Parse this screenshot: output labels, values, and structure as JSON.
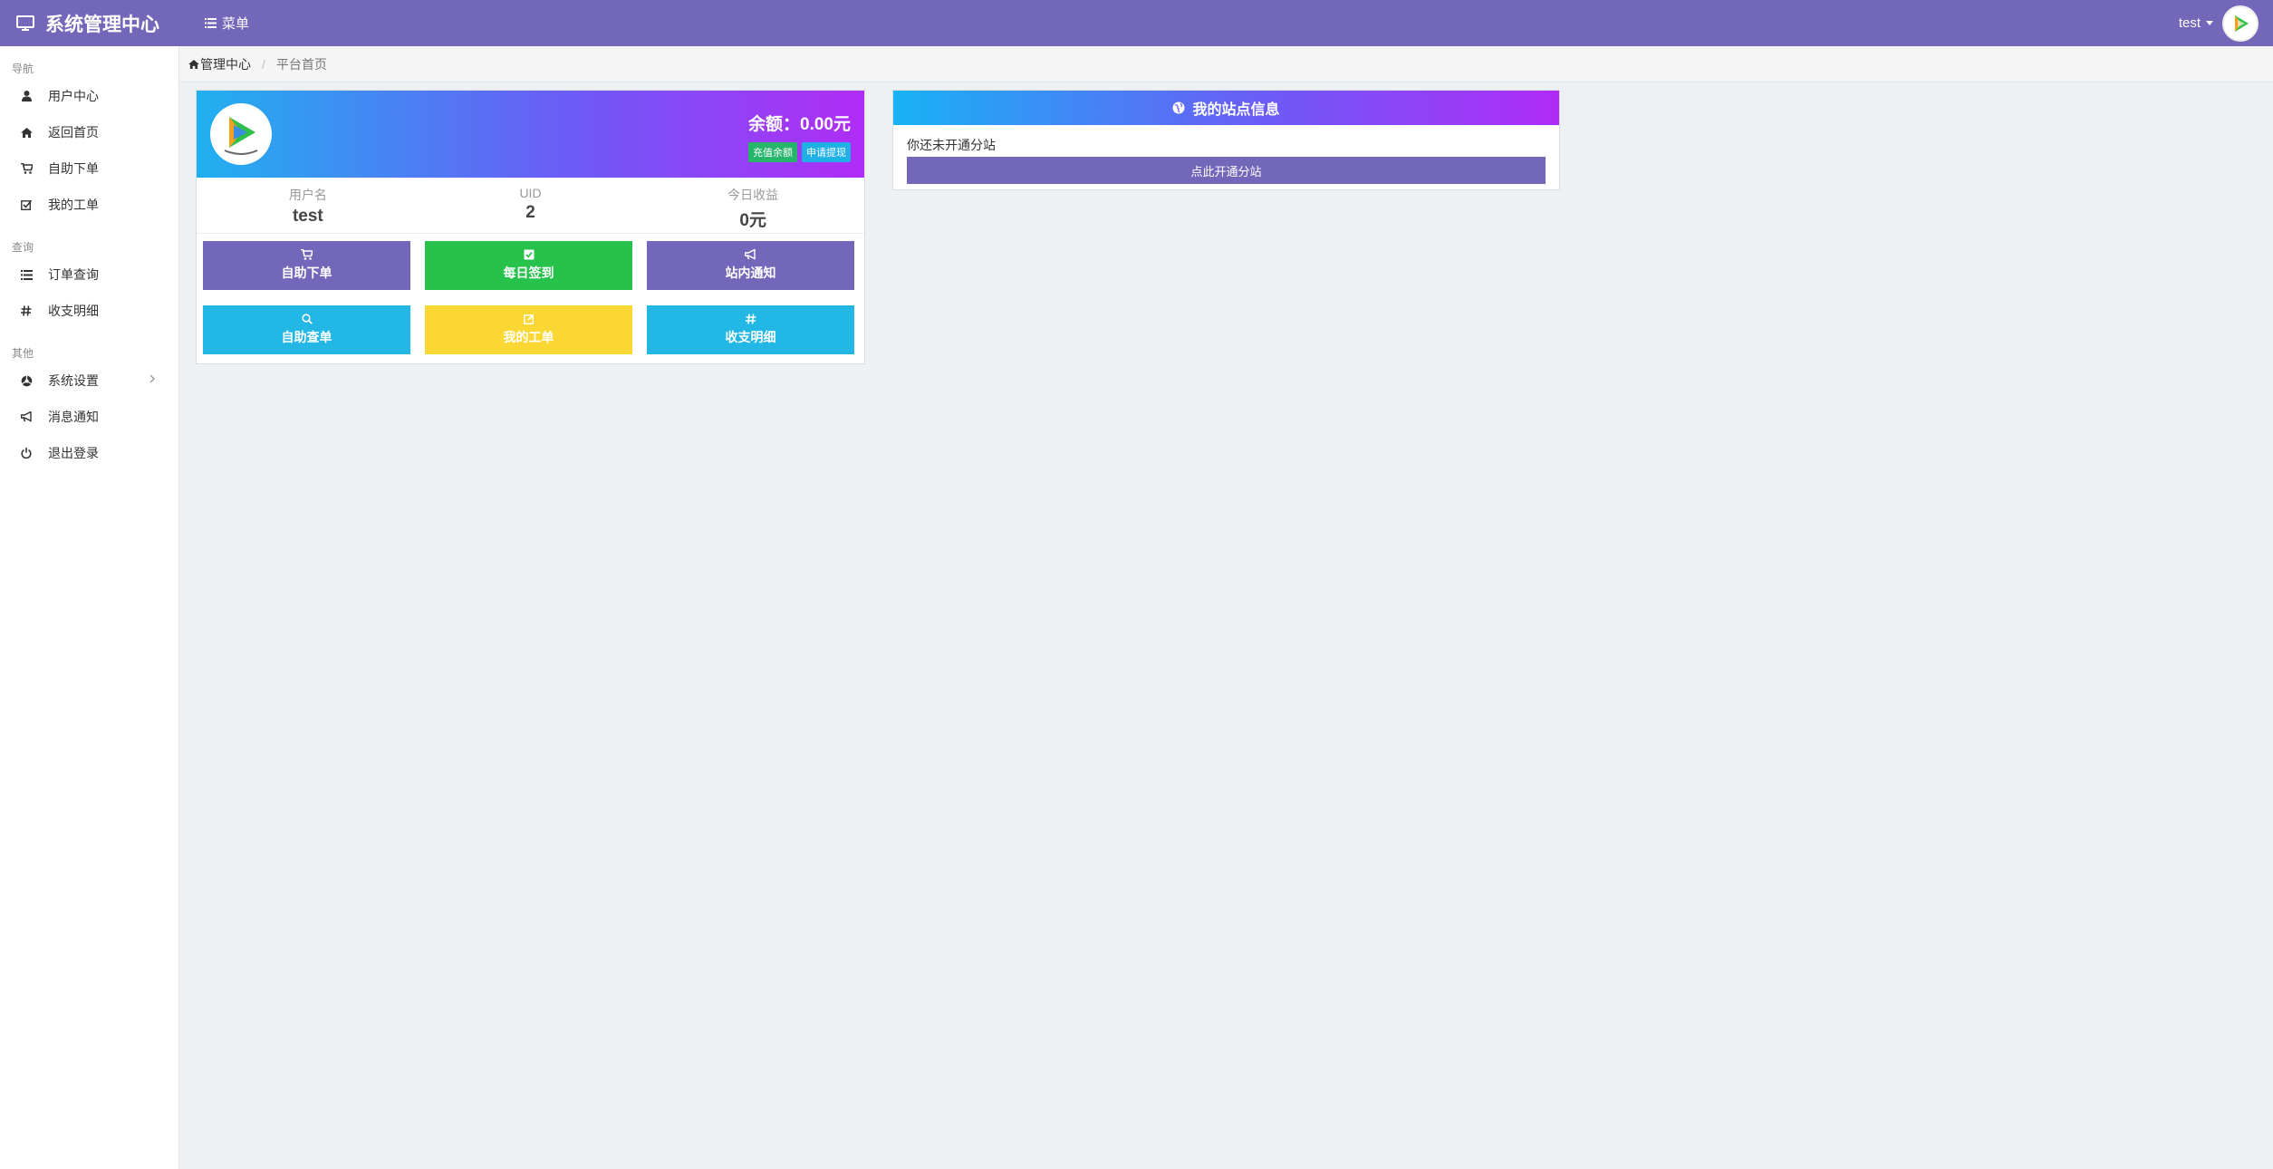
{
  "header": {
    "brand": "系统管理中心",
    "menu_label": "菜单",
    "user_name": "test"
  },
  "sidebar": {
    "sections": [
      {
        "title": "导航",
        "items": [
          {
            "label": "用户中心",
            "icon": "user-icon"
          },
          {
            "label": "返回首页",
            "icon": "home-icon"
          },
          {
            "label": "自助下单",
            "icon": "cart-icon"
          },
          {
            "label": "我的工单",
            "icon": "check-square-icon"
          }
        ]
      },
      {
        "title": "查询",
        "items": [
          {
            "label": "订单查询",
            "icon": "list-icon"
          },
          {
            "label": "收支明细",
            "icon": "hash-icon"
          }
        ]
      },
      {
        "title": "其他",
        "items": [
          {
            "label": "系统设置",
            "icon": "settings-icon"
          },
          {
            "label": "消息通知",
            "icon": "bullhorn-icon"
          },
          {
            "label": "退出登录",
            "icon": "power-icon"
          }
        ]
      }
    ]
  },
  "breadcrumb": {
    "home": "管理中心",
    "current": "平台首页"
  },
  "account": {
    "balance_text": "余额：0.00元",
    "recharge_label": "充值余额",
    "withdraw_label": "申请提现",
    "stats": [
      {
        "label": "用户名",
        "value": "test"
      },
      {
        "label": "UID",
        "value": "2"
      },
      {
        "label": "今日收益",
        "value": "0元"
      }
    ],
    "actions": [
      {
        "label": "自助下单",
        "icon": "cart-icon",
        "color": "#7367b9"
      },
      {
        "label": "每日签到",
        "icon": "check-square-icon",
        "color": "#27c24c"
      },
      {
        "label": "站内通知",
        "icon": "bullhorn-icon",
        "color": "#7367b9"
      },
      {
        "label": "自助查单",
        "icon": "search-icon",
        "color": "#23b7e5"
      },
      {
        "label": "我的工单",
        "icon": "edit-square-icon",
        "color": "#fad733"
      },
      {
        "label": "收支明细",
        "icon": "hash-icon",
        "color": "#23b7e5"
      }
    ]
  },
  "site": {
    "title": "我的站点信息",
    "message": "你还未开通分站",
    "open_label": "点此开通分站"
  },
  "colors": {
    "primary": "#7367b9",
    "success": "#27c24c",
    "info": "#23b7e5",
    "warning": "#fad733"
  }
}
